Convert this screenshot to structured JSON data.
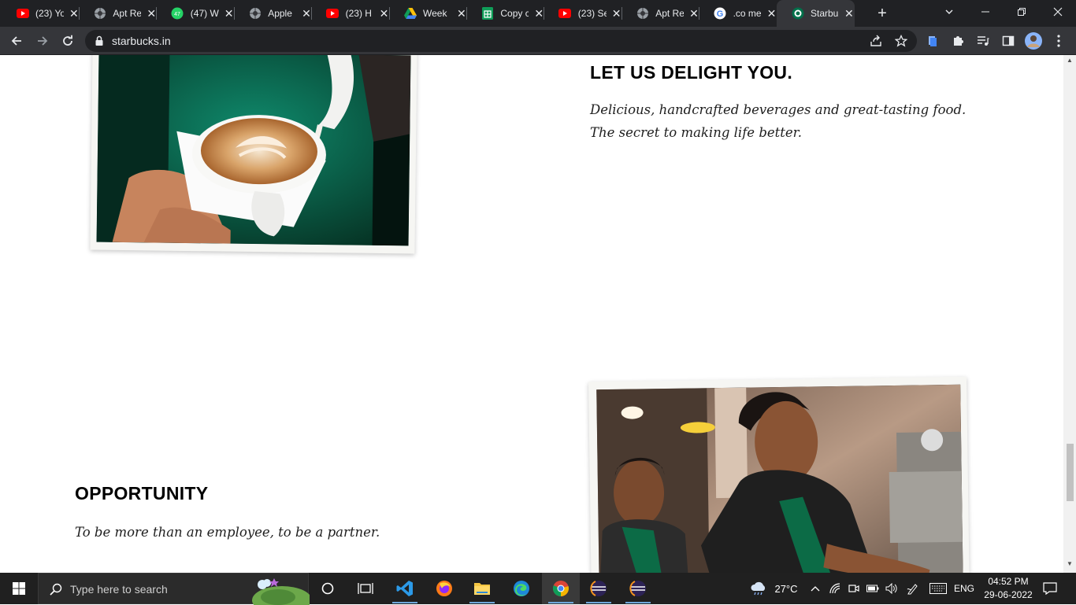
{
  "browser": {
    "tabs": [
      {
        "title": "(23) Yo",
        "icon": "youtube-icon"
      },
      {
        "title": "Apt Re",
        "icon": "globe-icon"
      },
      {
        "title": "(47) W",
        "icon": "whatsapp-icon"
      },
      {
        "title": "Apple",
        "icon": "globe-icon"
      },
      {
        "title": "(23) H",
        "icon": "youtube-icon"
      },
      {
        "title": "Week",
        "icon": "google-drive-icon"
      },
      {
        "title": "Copy c",
        "icon": "google-sheets-icon"
      },
      {
        "title": "(23) Se",
        "icon": "youtube-icon"
      },
      {
        "title": "Apt Re",
        "icon": "globe-icon"
      },
      {
        "title": ".co me",
        "icon": "google-icon"
      },
      {
        "title": "Starbu",
        "icon": "starbucks-icon",
        "active": true
      }
    ],
    "url": "starbucks.in"
  },
  "page": {
    "section1": {
      "heading": "LET US DELIGHT YOU.",
      "body": "Delicious, handcrafted beverages and great-tasting food. The secret to making life better."
    },
    "section2": {
      "heading": "OPPORTUNITY",
      "body": "To be more than an employee, to be a partner."
    }
  },
  "taskbar": {
    "search_placeholder": "Type here to search",
    "weather": "27°C",
    "language": "ENG",
    "time": "04:52 PM",
    "date": "29-06-2022"
  },
  "colors": {
    "tab_strip": "#202124",
    "toolbar": "#35363a",
    "starbucks_green": "#00704a",
    "taskbar": "#202020"
  }
}
